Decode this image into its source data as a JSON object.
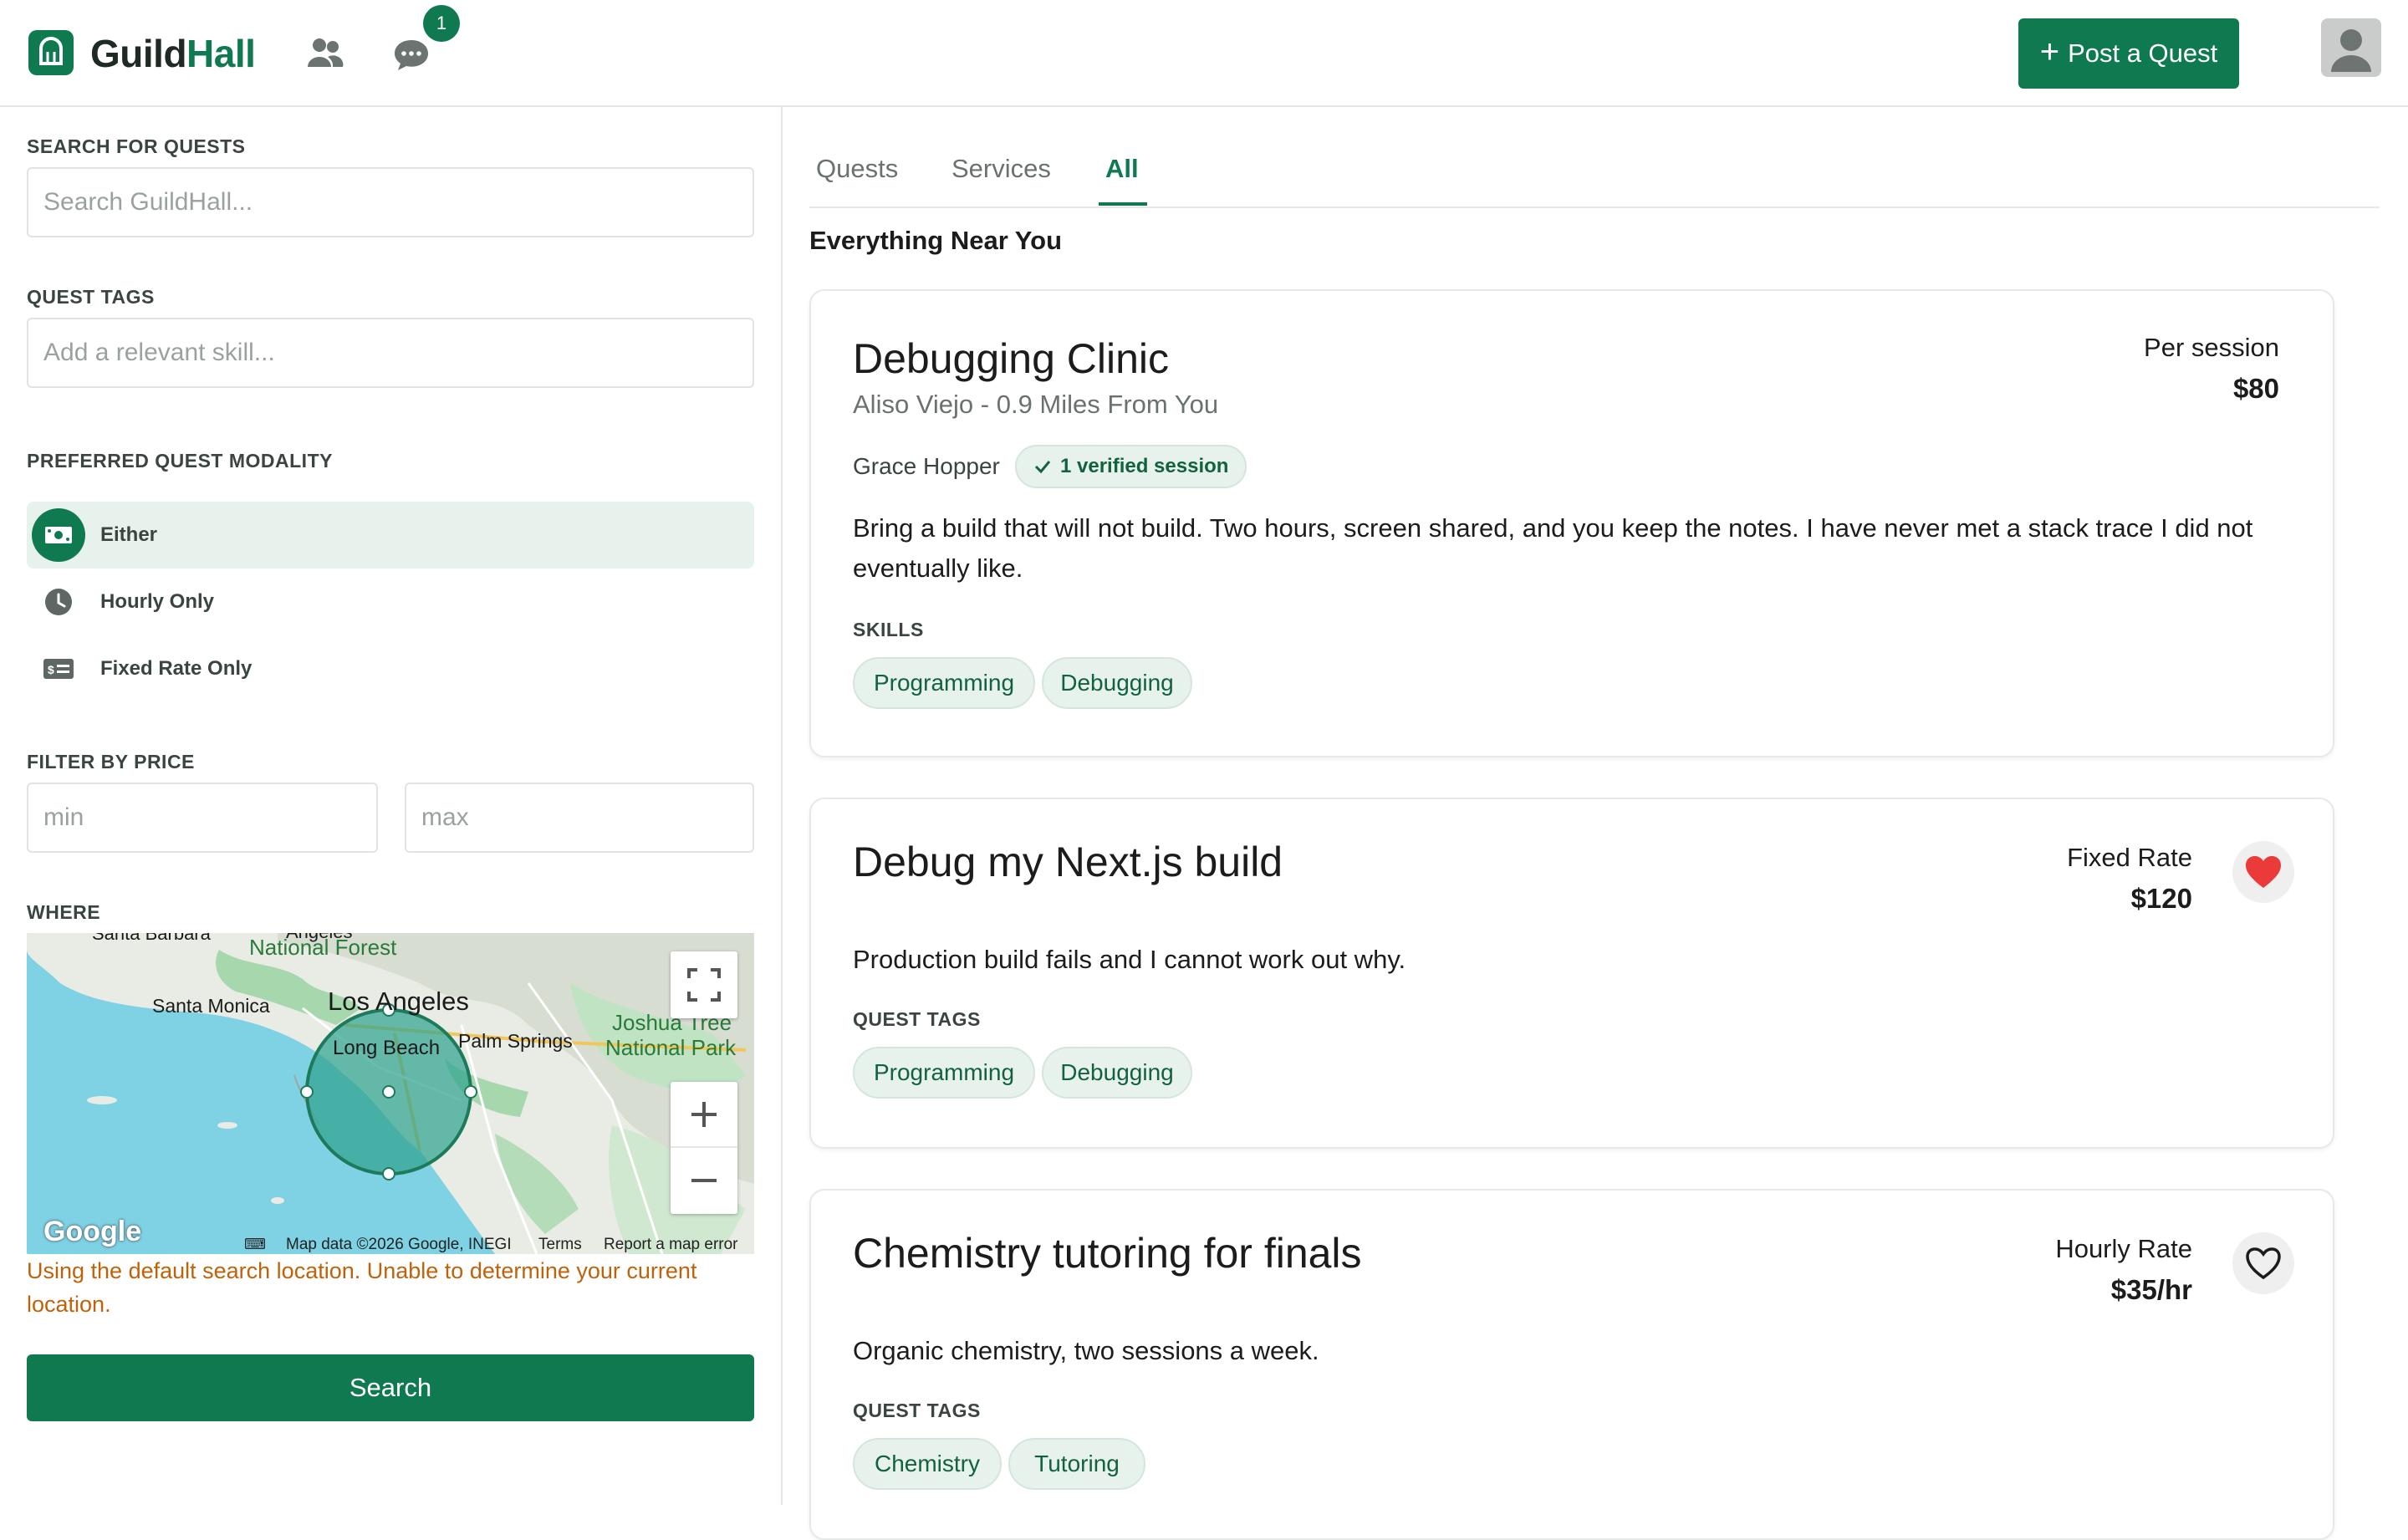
{
  "header": {
    "brand_part1": "Guild",
    "brand_part2": "Hall",
    "messages_badge": "1",
    "post_button_label": "Post a Quest",
    "accent_color": "#0f7a50"
  },
  "sidebar": {
    "search_label": "SEARCH FOR QUESTS",
    "search_placeholder": "Search GuildHall...",
    "tags_label": "QUEST TAGS",
    "tags_placeholder": "Add a relevant skill...",
    "modality_label": "PREFERRED QUEST MODALITY",
    "modality_options": [
      {
        "label": "Either",
        "icon": "money-icon",
        "selected": true
      },
      {
        "label": "Hourly Only",
        "icon": "clock-icon",
        "selected": false
      },
      {
        "label": "Fixed Rate Only",
        "icon": "receipt-icon",
        "selected": false
      }
    ],
    "price_label": "FILTER BY PRICE",
    "price_min_placeholder": "min",
    "price_max_placeholder": "max",
    "where_label": "WHERE",
    "map": {
      "labels": {
        "santa_barbara": "Santa Barbara",
        "forest": "National Forest",
        "santa_monica": "Santa Monica",
        "los_angeles": "Los Angeles",
        "long_beach": "Long Beach",
        "palm_springs": "Palm Springs",
        "joshua_tree_1": "Joshua Tree",
        "joshua_tree_2": "National Park",
        "angeles": "Angeles"
      },
      "google": "Google",
      "map_data": "Map data ©2026 Google, INEGI",
      "terms": "Terms",
      "report": "Report a map error"
    },
    "location_warning": "Using the default search location. Unable to determine your current location.",
    "search_button": "Search"
  },
  "main": {
    "tabs": [
      {
        "label": "Quests",
        "active": false
      },
      {
        "label": "Services",
        "active": false
      },
      {
        "label": "All",
        "active": true
      }
    ],
    "section_title": "Everything Near You",
    "cards": [
      {
        "title": "Debugging Clinic",
        "subtitle": "Aliso Viejo - 0.9 Miles From You",
        "provider": "Grace Hopper",
        "verified": "1 verified session",
        "description": "Bring a build that will not build. Two hours, screen shared, and you keep the notes. I have never met a stack trace I did not eventually like.",
        "tags_label": "SKILLS",
        "tags": [
          "Programming",
          "Debugging"
        ],
        "price_type": "Per session",
        "price": "$80"
      },
      {
        "title": "Debug my Next.js build",
        "description": "Production build fails and I cannot work out why.",
        "tags_label": "QUEST TAGS",
        "tags": [
          "Programming",
          "Debugging"
        ],
        "price_type": "Fixed Rate",
        "price": "$120",
        "favorited": true
      },
      {
        "title": "Chemistry tutoring for finals",
        "description": "Organic chemistry, two sessions a week.",
        "tags_label": "QUEST TAGS",
        "tags": [
          "Chemistry",
          "Tutoring"
        ],
        "price_type": "Hourly Rate",
        "price": "$35/hr",
        "favorited": false
      }
    ]
  }
}
